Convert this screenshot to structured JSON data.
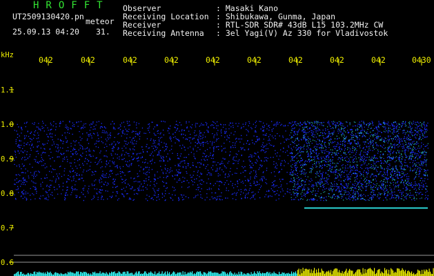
{
  "header": {
    "brand": "HROFFT",
    "filename": "UT2509130420.pn",
    "mode": "meteor",
    "datetime": "25.09.13 04:20",
    "count": "31.",
    "info": [
      {
        "label": "Observer",
        "value": ": Masaki Kano"
      },
      {
        "label": "Receiving Location",
        "value": ": Shibukawa, Gunma, Japan"
      },
      {
        "label": "Receiver",
        "value": ": RTL-SDR SDR# 43dB L15 103.2MHz CW"
      },
      {
        "label": "Receiving Antenna",
        "value": ": 3el Yagi(V) Az 330 for Vladivostok"
      }
    ]
  },
  "colors": {
    "background": "#000000",
    "header_green": "#33e633",
    "label_yellow": "#f0f000",
    "signal_blue": "#1a2cff",
    "signal_cyan": "#33ffff"
  },
  "chart_data": {
    "type": "heatmap",
    "ylabel": "kHz",
    "y_ticks": [
      "1.1",
      "1.0",
      "0.9",
      "0.8",
      "0.7",
      "0.6"
    ],
    "x_ticks": [
      "042",
      "042",
      "042",
      "042",
      "042",
      "042",
      "042",
      "042",
      "042",
      "0430"
    ],
    "ylim": [
      0.58,
      1.15
    ],
    "noise_band_khz": [
      0.78,
      1.01
    ],
    "intensity_increase_from_tick_index": 7,
    "carrier_line_khz": 0.757,
    "reference_lines_khz": [
      0.62,
      0.6
    ],
    "grid": false
  }
}
